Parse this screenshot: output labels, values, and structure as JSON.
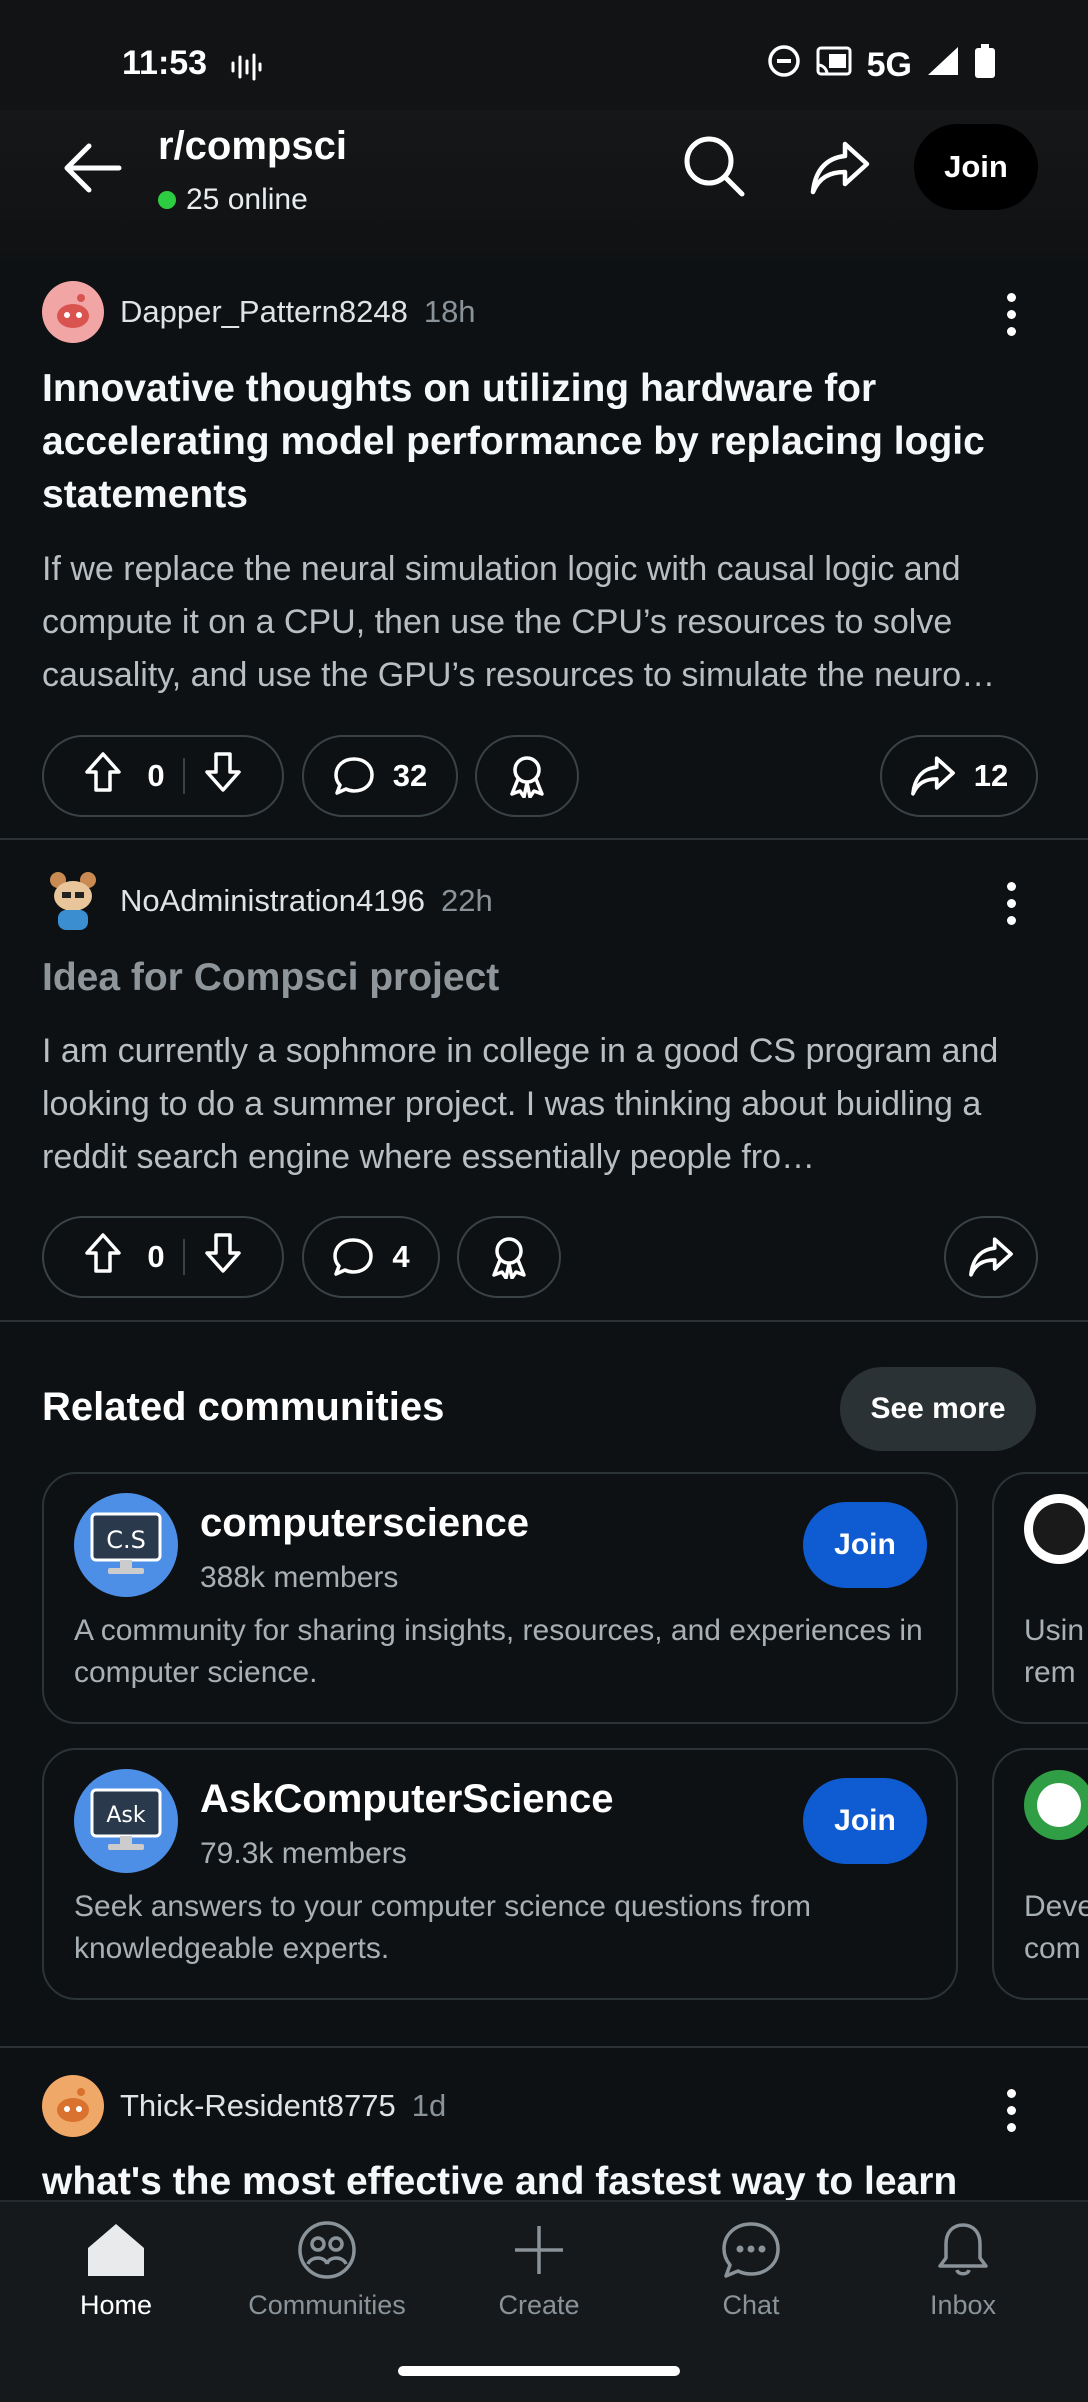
{
  "status_bar": {
    "time": "11:53",
    "network": "5G"
  },
  "header": {
    "subreddit": "r/compsci",
    "online": "25 online",
    "join_label": "Join"
  },
  "posts": [
    {
      "author": "Dapper_Pattern8248",
      "age": "18h",
      "title": "Innovative thoughts on utilizing hardware for accelerating model performance by replacing logic statements",
      "body": "If we replace the neural simulation logic with causal logic and compute it on a CPU, then use the CPU’s resources to solve causality, and use the GPU’s resources to simulate the neuro…",
      "votes": "0",
      "comments": "32",
      "shares": "12"
    },
    {
      "author": "NoAdministration4196",
      "age": "22h",
      "title": "Idea for Compsci project",
      "body": "I am currently a sophmore in college in a good CS program and looking to do a summer project. I was thinking about buidling a reddit search engine where essentially people fro…",
      "votes": "0",
      "comments": "4"
    },
    {
      "author": "Thick-Resident8775",
      "age": "1d",
      "title": "what's the most effective and fastest way to learn"
    }
  ],
  "related": {
    "heading": "Related communities",
    "see_more": "See more",
    "communities": [
      {
        "name": "computerscience",
        "members": "388k members",
        "description": "A community for sharing insights, resources, and experiences in computer science.",
        "icon_text": "C.S",
        "join": "Join"
      },
      {
        "name": "AskComputerScience",
        "members": "79.3k members",
        "description": "Seek answers to your computer science questions from knowledgeable experts.",
        "icon_text": "Ask",
        "join": "Join"
      }
    ],
    "peek": [
      {
        "text1": "Usin",
        "text2": "rem"
      },
      {
        "text1": "Deve",
        "text2": "com"
      }
    ]
  },
  "bottom_nav": [
    {
      "label": "Home",
      "icon": "home-icon",
      "active": true
    },
    {
      "label": "Communities",
      "icon": "communities-icon"
    },
    {
      "label": "Create",
      "icon": "plus-icon"
    },
    {
      "label": "Chat",
      "icon": "chat-icon"
    },
    {
      "label": "Inbox",
      "icon": "bell-icon"
    }
  ],
  "colors": {
    "background": "#0e1113",
    "join_blue": "#0f5bd1",
    "online_green": "#2ecc40"
  }
}
